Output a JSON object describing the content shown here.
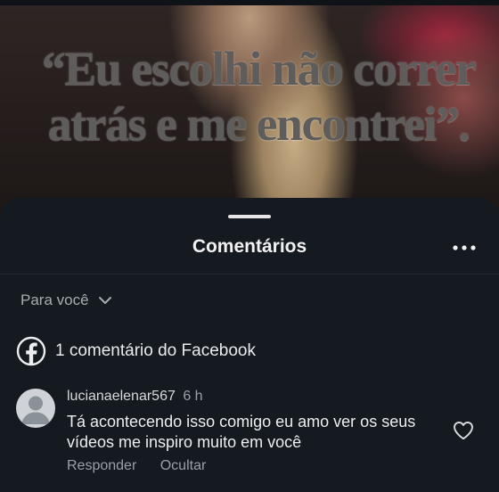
{
  "video": {
    "quote": "“Eu escolhi não correr\natrás e me encontrei”."
  },
  "sheet": {
    "title": "Comentários",
    "more_icon": "more-horizontal-icon"
  },
  "filter": {
    "label": "Para você",
    "icon": "chevron-down-icon"
  },
  "facebook": {
    "icon": "facebook-icon",
    "label": "1 comentário do Facebook"
  },
  "comments": [
    {
      "username": "lucianaelenar567",
      "time": "6 h",
      "text": "Tá acontecendo isso comigo eu amo ver os seus vídeos me inspiro muito em você",
      "reply_label": "Responder",
      "hide_label": "Ocultar",
      "like_icon": "heart-icon"
    }
  ]
}
